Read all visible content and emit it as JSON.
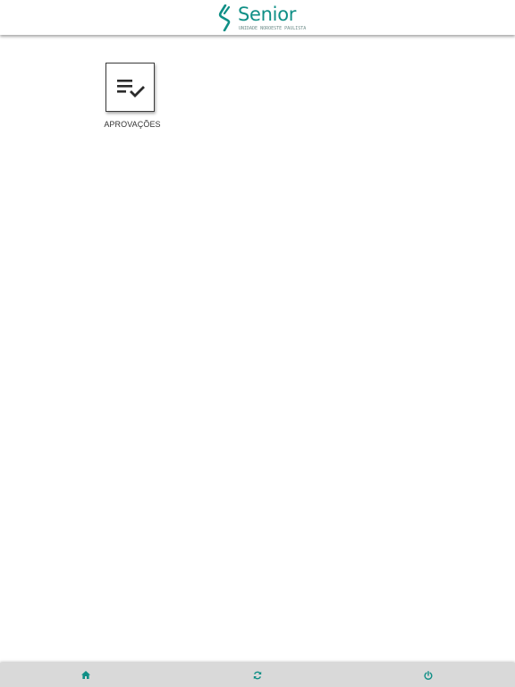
{
  "header": {
    "logo_text": "Senior",
    "logo_subtitle": "UNIDADE NOROESTE PAULISTA"
  },
  "apps": [
    {
      "label": "APROVAÇÕES",
      "icon": "playlist-check-icon"
    }
  ],
  "footer": {
    "home_icon": "home-icon",
    "refresh_icon": "refresh-icon",
    "power_icon": "power-icon"
  },
  "colors": {
    "brand": "#0f8f86",
    "footer_background": "#d9d9d9",
    "icon_dark": "#2b2b2b"
  }
}
